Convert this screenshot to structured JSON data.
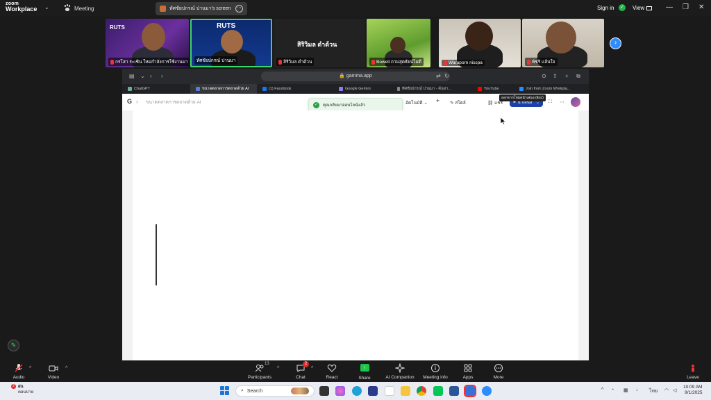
{
  "zoom": {
    "brand_line1": "zoom",
    "brand_line2": "Workplace",
    "meeting_label": "Meeting",
    "share_title": "ทัศชัยปกรณ์ ปานมา's screen",
    "signin_label": "Sign in",
    "view_label": "View"
  },
  "participants": [
    {
      "name": "กรโสา ระเชิน ใหม่กำลังการใช้งานมา",
      "muted": true
    },
    {
      "name": "ทัศชัยปกรณ์ ปานมา",
      "muted": true,
      "active_speaker": true
    },
    {
      "name": "สิริวิมล ดำด้วน",
      "muted": true,
      "display_label": "สิริวิมล ดำด้วน"
    },
    {
      "name": "Bowell ถามสุดธัยน์ไม่ดี",
      "muted": true
    },
    {
      "name": "Waraporn nisspa",
      "muted": true
    },
    {
      "name": "พัชริ แล้นใจ",
      "muted": true
    }
  ],
  "browser": {
    "url": "gamma.app",
    "tabs": [
      {
        "label": "ChatGPT",
        "active": false,
        "color": "#74aa9c"
      },
      {
        "label": "ขนาดตลาดการตลาดด้วย AI",
        "active": true,
        "color": "#5a7dd6"
      },
      {
        "label": "(1) Facebook",
        "active": false,
        "color": "#1877f2"
      },
      {
        "label": "Google Gemini",
        "active": false,
        "color": "#8e7bf0"
      },
      {
        "label": "ทัศชัยปกรณ์ ปานมา - ค้นหา...",
        "active": false,
        "color": "#888888"
      },
      {
        "label": "YouTube",
        "active": false,
        "color": "#ff0000"
      },
      {
        "label": "Join from Zoom Workpla...",
        "active": false,
        "color": "#2d8cff"
      }
    ]
  },
  "gamma": {
    "doc_title": "ขนาดตลาดการตลาดด้วย AI",
    "toast": "คุณกลับมาออนไลน์แล้ว",
    "autosave": "อัตโนมัติ",
    "add": "+",
    "theme_label": "สไตล์",
    "share_label": "แชร์",
    "present_label": "นำเสนอ",
    "tooltip": "ออกจากโหมดนำเสนอ (Esc)"
  },
  "toolbar": {
    "audio": "Audio",
    "video": "Video",
    "participants": "Participants",
    "participants_count": "13",
    "chat": "Chat",
    "chat_badge": "2",
    "react": "React",
    "share": "Share",
    "ai_companion": "AI Companion",
    "meeting_info": "Meeting info",
    "apps": "Apps",
    "more": "More",
    "leave": "Leave"
  },
  "taskbar": {
    "weather_line1": "ฝน",
    "weather_line2": "ตอนบ่าย",
    "weather_badge": "2",
    "search_placeholder": "Search",
    "lang": "ไทย",
    "time": "10:09 AM",
    "date": "9/1/2025"
  },
  "colors": {
    "zoom_blue": "#2d8cff",
    "active_speaker_border": "#3bd56b",
    "share_green": "#1dc44a",
    "gamma_present": "#1d3fa8"
  }
}
